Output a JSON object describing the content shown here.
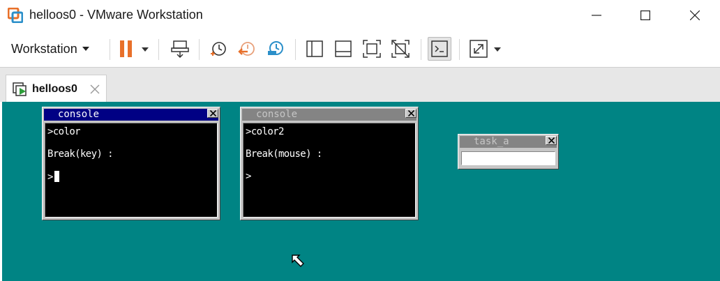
{
  "window": {
    "title": "helloos0 - VMware Workstation",
    "controls": [
      "minimize-icon",
      "maximize-icon",
      "close-icon"
    ]
  },
  "toolbar": {
    "workstation_label": "Workstation",
    "icons": [
      "pause-icon",
      "send-ctrl-alt-del-icon",
      "snapshot-take-icon",
      "snapshot-revert-icon",
      "snapshot-manager-icon",
      "show-library-icon",
      "show-thumbnail-bar-icon",
      "full-screen-icon",
      "unity-icon",
      "console-view-icon",
      "stretch-guest-icon"
    ],
    "colors": {
      "pause": "#e8702a",
      "revert": "#e8702a",
      "manager": "#2b8fc9"
    }
  },
  "tabs": [
    {
      "label": "helloos0"
    }
  ],
  "vm": {
    "desktop_color": "#008484",
    "console1": {
      "title": "console",
      "lines": [
        ">color",
        "Break(key) :",
        ">"
      ]
    },
    "console2": {
      "title": "console",
      "lines": [
        ">color2",
        "Break(mouse) :",
        ">"
      ]
    },
    "task_a": {
      "title": "task_a"
    }
  }
}
